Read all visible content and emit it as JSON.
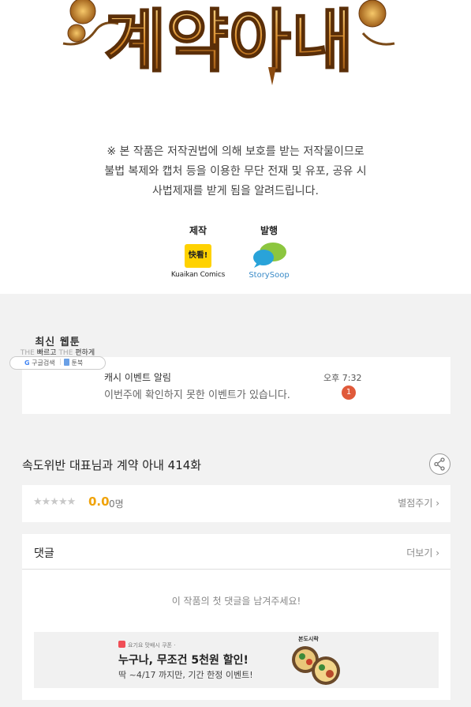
{
  "title_art": {
    "text": "계약아내"
  },
  "notice": {
    "lines": [
      "※ 본 작품은 저작권법에 의해 보호를 받는 저작물이므로",
      "불법 복제와 캡처 등을  이용한 무단 전재 및 유포, 공유 시",
      "사법제재를  받게 됨을 알려드립니다."
    ]
  },
  "credits": {
    "production_label": "제작",
    "production_logo_text": "快看!",
    "production_name": "Kuaikan Comics",
    "publisher_label": "발행",
    "publisher_name": "StorySoop"
  },
  "widget": {
    "title": "최신 웹툰",
    "sub_the1": "THE",
    "sub_fast": "빠르고",
    "sub_the2": "THE",
    "sub_easy": "편하게",
    "google_search": "구글검색",
    "bookmark": "툰북"
  },
  "event": {
    "title": "캐시 이벤트 알림",
    "desc": "이번주에 확인하지 못한 이벤트가 있습니다.",
    "time": "오후 7:32",
    "badge": "1"
  },
  "episode": {
    "title": "속도위반 대표님과 계약 아내 414화"
  },
  "rating": {
    "stars": "★★★★★",
    "score": "0.0",
    "count": "0명",
    "rate_link": "별점주기 ›"
  },
  "comments": {
    "title": "댓글",
    "more": "더보기 ›",
    "empty": "이 작품의 첫 댓글을 남겨주세요!"
  },
  "ad": {
    "brand": "요기요 맛배시 쿠폰 ·",
    "title": "누구나, 무조건 5천원 할인!",
    "sub": "딱 ~4/17 까지만, 기간 한정 이벤트!",
    "art_label": "본도시락"
  },
  "colors": {
    "page_gray": "#f2f2f2",
    "score_orange": "#f0a30a",
    "badge_red": "#e05a3a",
    "kuaikan_yellow": "#ffd200",
    "storysoop_blue": "#3a8bc8"
  }
}
